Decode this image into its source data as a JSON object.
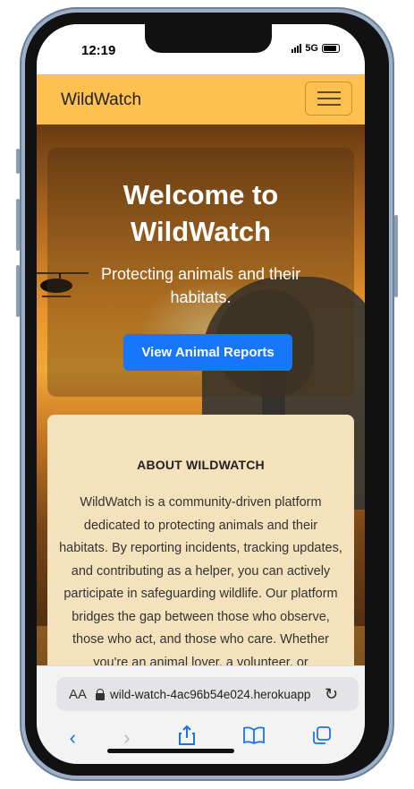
{
  "status": {
    "time": "12:19",
    "network": "5G"
  },
  "navbar": {
    "brand": "WildWatch"
  },
  "hero": {
    "title": "Welcome to WildWatch",
    "subtitle": "Protecting animals and their habitats.",
    "button_label": "View Animal Reports"
  },
  "about": {
    "title": "ABOUT WILDWATCH",
    "text": "WildWatch is a community-driven platform dedicated to protecting animals and their habitats. By reporting incidents, tracking updates, and contributing as a helper, you can actively participate in safeguarding wildlife. Our platform bridges the gap between those who observe, those who act, and those who care. Whether you're an animal lover, a volunteer, or"
  },
  "browser": {
    "text_size_label": "AA",
    "url": "wild-watch-4ac96b54e024.herokuapp",
    "icons": [
      "lock-icon",
      "reload-icon",
      "back-icon",
      "forward-icon",
      "share-icon",
      "bookmarks-icon",
      "tabs-icon"
    ]
  },
  "colors": {
    "navbar": "#fec04e",
    "button": "#1677fa",
    "about_bg": "#f3e2bc",
    "link": "#1a73e8"
  }
}
